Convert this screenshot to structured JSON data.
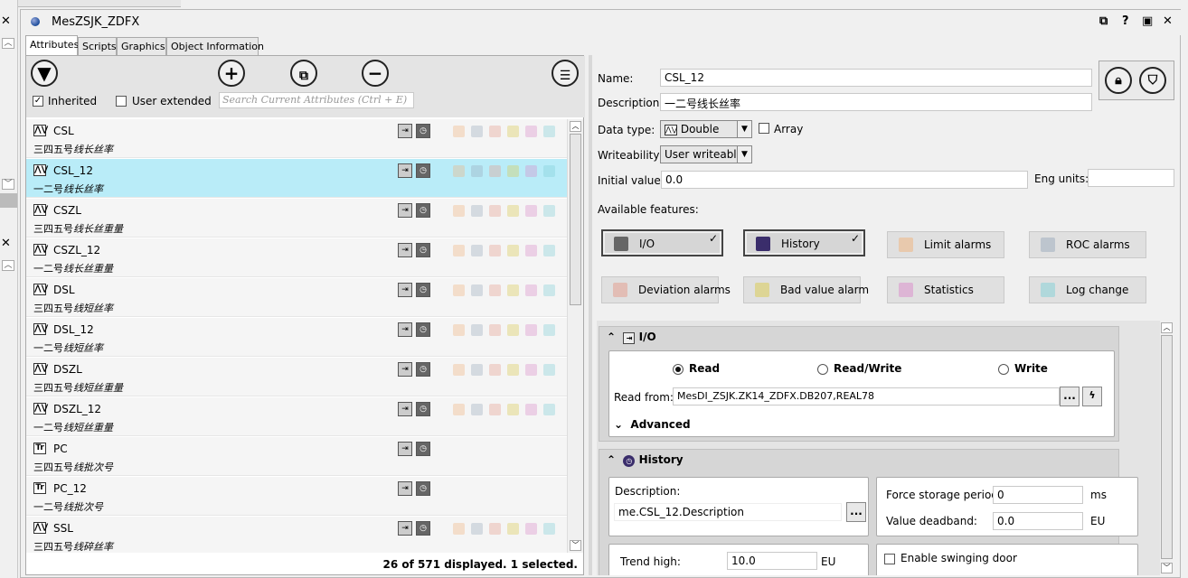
{
  "window": {
    "title": "MesZSJK_ZDFX"
  },
  "tabs": [
    "Attributes",
    "Scripts",
    "Graphics",
    "Object Information"
  ],
  "filters": {
    "inherited_label": "Inherited",
    "user_extended_label": "User extended",
    "search_placeholder": "Search Current Attributes (Ctrl + E)",
    "inherited_checked": true,
    "user_extended_checked": false
  },
  "attributes": [
    {
      "name": "CSL",
      "prefix": "三四五号",
      "desc": "线长丝率",
      "type": "analog",
      "has_alarms": true,
      "selected": false
    },
    {
      "name": "CSL_12",
      "prefix": "一二号",
      "desc": "线长丝率",
      "type": "analog",
      "has_alarms": true,
      "selected": true
    },
    {
      "name": "CSZL",
      "prefix": "三四五号",
      "desc": "线长丝重量",
      "type": "analog",
      "has_alarms": true,
      "selected": false
    },
    {
      "name": "CSZL_12",
      "prefix": "一二号",
      "desc": "线长丝重量",
      "type": "analog",
      "has_alarms": true,
      "selected": false
    },
    {
      "name": "DSL",
      "prefix": "三四五号",
      "desc": "线短丝率",
      "type": "analog",
      "has_alarms": true,
      "selected": false
    },
    {
      "name": "DSL_12",
      "prefix": "一二号",
      "desc": "线短丝率",
      "type": "analog",
      "has_alarms": true,
      "selected": false
    },
    {
      "name": "DSZL",
      "prefix": "三四五号",
      "desc": "线短丝重量",
      "type": "analog",
      "has_alarms": true,
      "selected": false
    },
    {
      "name": "DSZL_12",
      "prefix": "一二号",
      "desc": "线短丝重量",
      "type": "analog",
      "has_alarms": true,
      "selected": false
    },
    {
      "name": "PC",
      "prefix": "三四五号",
      "desc": "线批次号",
      "type": "string",
      "has_alarms": false,
      "selected": false
    },
    {
      "name": "PC_12",
      "prefix": "一二号",
      "desc": "线批次号",
      "type": "string",
      "has_alarms": false,
      "selected": false
    },
    {
      "name": "SSL",
      "prefix": "三四五号",
      "desc": "线碎丝率",
      "type": "analog",
      "has_alarms": true,
      "selected": false
    }
  ],
  "status": "26 of 571 displayed. 1 selected.",
  "props": {
    "name_label": "Name:",
    "name_value": "CSL_12",
    "description_label": "Description:",
    "description_value": "一二号线长丝率",
    "datatype_label": "Data type:",
    "datatype_value": "Double",
    "array_label": "Array",
    "writeability_label": "Writeability:",
    "writeability_value": "User writeable",
    "initial_label": "Initial value:",
    "initial_value": "0.0",
    "eng_label": "Eng units:",
    "eng_value": "",
    "features_label": "Available features:"
  },
  "features": [
    {
      "label": "I/O",
      "on": true,
      "color": "#666"
    },
    {
      "label": "History",
      "on": true,
      "color": "#3a2d6b"
    },
    {
      "label": "Limit alarms",
      "on": false,
      "color": "#f0b27a"
    },
    {
      "label": "ROC alarms",
      "on": false,
      "color": "#9ab"
    },
    {
      "label": "Deviation alarms",
      "on": false,
      "color": "#e49a8a"
    },
    {
      "label": "Bad value alarm",
      "on": false,
      "color": "#d9c94a"
    },
    {
      "label": "Statistics",
      "on": false,
      "color": "#d98ac9"
    },
    {
      "label": "Log change",
      "on": false,
      "color": "#7fcfd6"
    }
  ],
  "io": {
    "header": "I/O",
    "read": "Read",
    "readwrite": "Read/Write",
    "write": "Write",
    "readfrom_label": "Read from:",
    "readfrom_value": "MesDI_ZSJK.ZK14_ZDFX.DB207,REAL78",
    "advanced": "Advanced",
    "browse": "..."
  },
  "history": {
    "header": "History",
    "desc_label": "Description:",
    "desc_value": "me.CSL_12.Description",
    "force_label": "Force storage period:",
    "force_value": "0",
    "force_unit": "ms",
    "deadband_label": "Value deadband:",
    "deadband_value": "0.0",
    "deadband_unit": "EU",
    "trend_label": "Trend high:",
    "trend_value": "10.0",
    "trend_unit": "EU",
    "swing_label": "Enable swinging door",
    "browse": "..."
  }
}
